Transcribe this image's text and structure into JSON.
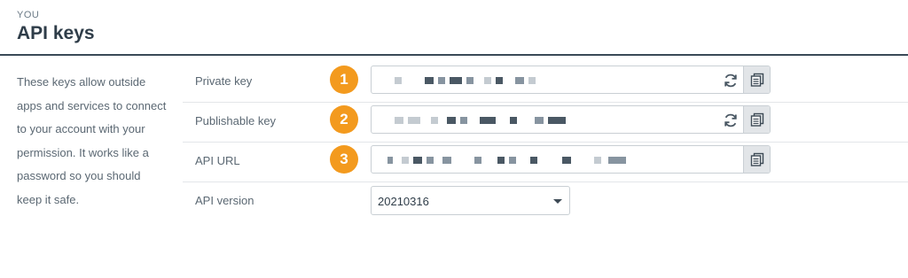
{
  "header": {
    "eyebrow": "YOU",
    "title": "API keys"
  },
  "description": "These keys allow outside apps and services to connect to your account with your permission. It works like a password so you should keep it safe.",
  "rows": [
    {
      "label": "Private key",
      "badge": "1",
      "value_masked": true,
      "refresh_icon": "refresh-icon",
      "copy_icon": "copy-icon"
    },
    {
      "label": "Publishable key",
      "badge": "2",
      "value_masked": true,
      "refresh_icon": "refresh-icon",
      "copy_icon": "copy-icon"
    },
    {
      "label": "API URL",
      "badge": "3",
      "value_masked": true,
      "copy_icon": "copy-icon"
    },
    {
      "label": "API version",
      "selected": "20210316"
    }
  ],
  "colors": {
    "badge": "#f39a1e",
    "title": "#2f3d49",
    "rule": "#3a4a57"
  }
}
